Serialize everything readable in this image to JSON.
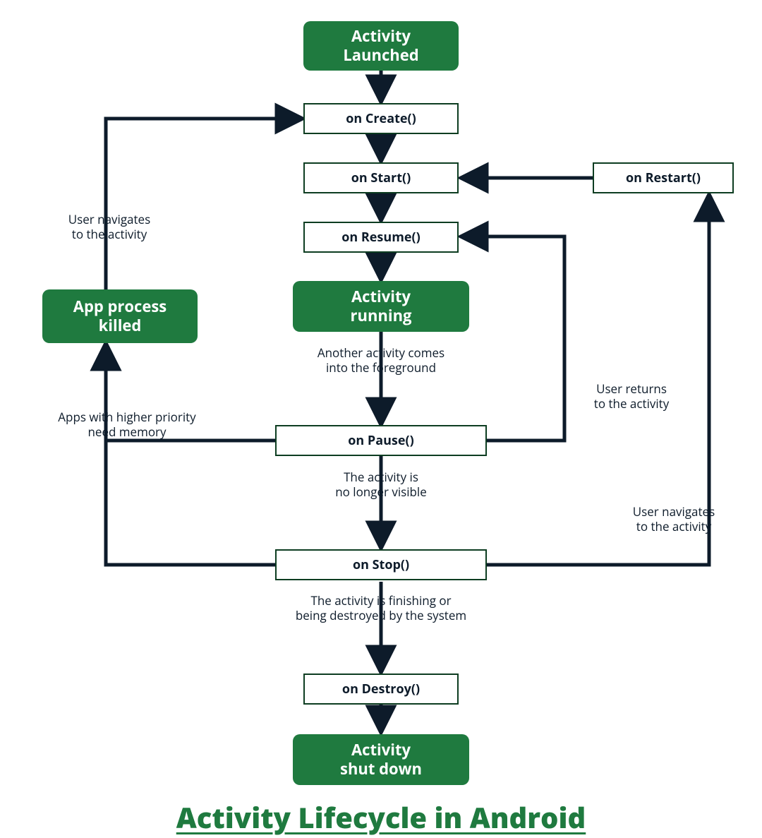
{
  "title": "Activity Lifecycle in Android",
  "nodes": {
    "launched": "Activity\nLaunched",
    "onCreate": "on Create()",
    "onStart": "on Start()",
    "onResume": "on Resume()",
    "running": "Activity\nrunning",
    "onPause": "on Pause()",
    "onStop": "on Stop()",
    "onDestroy": "on Destroy()",
    "shutdown": "Activity\nshut down",
    "onRestart": "on Restart()",
    "appKilled": "App process\nkilled"
  },
  "labels": {
    "userNavigatesToActivityLeft": "User navigates\nto the activity",
    "anotherActivityForeground": "Another activity comes\ninto the foreground",
    "higherPriorityMemory": "Apps with higher priority\nneed memory",
    "activityNoLongerVisible": "The activity is\nno longer visible",
    "userReturnsToActivity": "User returns\nto the activity",
    "userNavigatesToActivityRight": "User navigates\nto the activity",
    "activityFinishing": "The activity is finishing or\nbeing destroyed by the system"
  },
  "colors": {
    "green": "#1f7a3f",
    "dark": "#0d1b2a",
    "darkGreen": "#0d3d21"
  }
}
